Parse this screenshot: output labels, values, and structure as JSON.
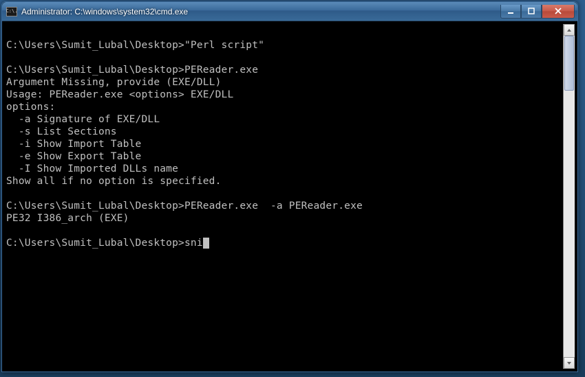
{
  "window": {
    "title": "Administrator: C:\\windows\\system32\\cmd.exe"
  },
  "terminal": {
    "lines": [
      "",
      "C:\\Users\\Sumit_Lubal\\Desktop>\"Perl script\"",
      "",
      "C:\\Users\\Sumit_Lubal\\Desktop>PEReader.exe",
      "Argument Missing, provide (EXE/DLL)",
      "Usage: PEReader.exe <options> EXE/DLL",
      "options:",
      "  -a Signature of EXE/DLL",
      "  -s List Sections",
      "  -i Show Import Table",
      "  -e Show Export Table",
      "  -I Show Imported DLLs name",
      "Show all if no option is specified.",
      "",
      "C:\\Users\\Sumit_Lubal\\Desktop>PEReader.exe  -a PEReader.exe",
      "PE32 I386_arch (EXE)",
      "",
      "C:\\Users\\Sumit_Lubal\\Desktop>sni"
    ],
    "current_input": "sni",
    "prompt": "C:\\Users\\Sumit_Lubal\\Desktop>"
  },
  "icons": {
    "cmd_label": "C:\\."
  }
}
